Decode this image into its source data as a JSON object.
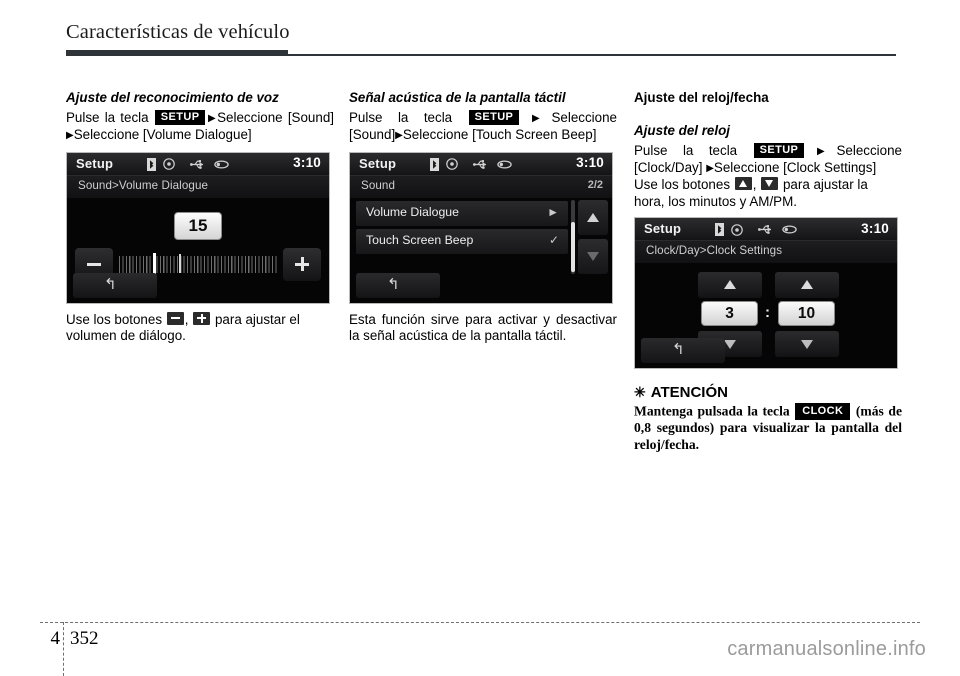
{
  "header": {
    "title": "Características de vehículo"
  },
  "column1": {
    "section_title": "Ajuste del reconocimiento de voz",
    "instruction_pre": "Pulse la tecla",
    "setup_key": "SETUP",
    "instruction_mid": "Seleccione [Sound]",
    "instruction_end": "Seleccione [Volume Dialogue]",
    "screen": {
      "title": "Setup",
      "time": "3:10",
      "breadcrumb": "Sound>Volume Dialogue",
      "volume_value": "15",
      "minus_label": "–",
      "plus_label": "+",
      "back_glyph": "↰"
    },
    "caption_pre": "Use los botones",
    "caption_sep": ",",
    "caption_end": "para ajustar el volumen de diálogo."
  },
  "column2": {
    "section_title": "Señal acústica de la pantalla táctil",
    "instruction_pre": "Pulse la tecla",
    "setup_key": "SETUP",
    "instruction_mid": "Seleccione [Sound]",
    "instruction_end": "Seleccione [Touch Screen Beep]",
    "screen": {
      "title": "Setup",
      "time": "3:10",
      "breadcrumb": "Sound",
      "page_indicator": "2/2",
      "rows": [
        {
          "label": "Volume Dialogue",
          "indicator": "►"
        },
        {
          "label": "Touch Screen Beep",
          "indicator": "✓"
        }
      ],
      "back_glyph": "↰"
    },
    "caption": "Esta función sirve para activar y desactivar la señal acústica de la pantalla táctil."
  },
  "column3": {
    "section_title": "Ajuste del reloj/fecha",
    "sub_title": "Ajuste del reloj",
    "instruction_pre": "Pulse la tecla",
    "setup_key": "SETUP",
    "instruction_mid": "Seleccione [Clock/Day]",
    "instruction_end": "Seleccione [Clock Settings]",
    "caption_pre": "Use los botones",
    "caption_sep": ",",
    "caption_end": "para ajustar la hora, los minutos y AM/PM.",
    "screen": {
      "title": "Setup",
      "time": "3:10",
      "breadcrumb": "Clock/Day>Clock Settings",
      "hour_value": "3",
      "colon": ":",
      "minute_value": "10",
      "back_glyph": "↰"
    },
    "attention": {
      "star": "✳",
      "title": "ATENCIÓN",
      "text_pre": "Mantenga pulsada la tecla",
      "clock_key": "CLOCK",
      "text_end": "(más de 0,8 segundos) para visualizar la pantalla del reloj/fecha."
    }
  },
  "footer": {
    "chapter": "4",
    "page": "352",
    "watermark": "carmanualsonline.info"
  }
}
